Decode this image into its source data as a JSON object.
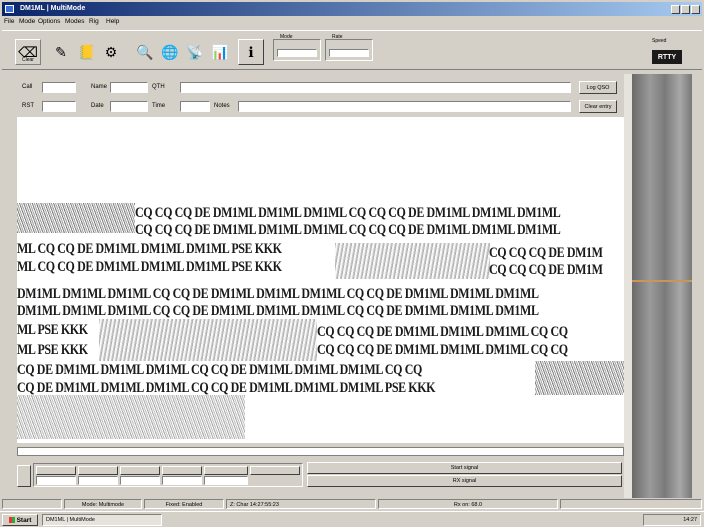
{
  "window": {
    "title": "DM1ML | MultiMode"
  },
  "menu": [
    "File",
    "Mode",
    "Options",
    "Modes",
    "Rig",
    "Help"
  ],
  "toolbar": {
    "buttons": [
      {
        "label": "Clear",
        "icon": "clear-icon",
        "glyph": "⌫"
      },
      {
        "label": "",
        "icon": "tools-icon",
        "glyph": "✎"
      },
      {
        "label": "",
        "icon": "log-icon",
        "glyph": "📒"
      },
      {
        "label": "",
        "icon": "settings-icon",
        "glyph": "⚙"
      },
      {
        "label": "",
        "icon": "search-icon",
        "glyph": "🔍"
      },
      {
        "label": "",
        "icon": "globe-icon",
        "glyph": "🌐"
      },
      {
        "label": "",
        "icon": "transmit-icon",
        "glyph": "📡"
      },
      {
        "label": "",
        "icon": "chart-icon",
        "glyph": "📊"
      },
      {
        "label": "",
        "icon": "info-icon",
        "glyph": "ℹ"
      }
    ],
    "group1": "Mode",
    "group2": "Rate"
  },
  "side": {
    "label": "Speed",
    "value": "RTTY"
  },
  "fields": {
    "call_label": "Call",
    "name_label": "Name",
    "qth_label": "QTH",
    "rst_label": "RST",
    "date_label": "Date",
    "time_label": "Time",
    "notes_label": "Notes",
    "log_button": "Log QSO",
    "clear_button": "Clear entry"
  },
  "decoder": {
    "lines": [
      "CQ CQ CQ DE DM1ML DM1ML DM1ML CQ CQ CQ DE DM1ML DM1ML DM1ML",
      "CQ CQ CQ DE DM1ML DM1ML DM1ML CQ CQ CQ DE DM1ML DM1ML DM1ML",
      "ML CQ CQ DE DM1ML DM1ML DM1ML PSE KKK",
      "ML CQ CQ DE DM1ML DM1ML DM1ML PSE KKK",
      "CQ CQ CQ DE DM1M",
      "CQ CQ CQ DE DM1M",
      "DM1ML DM1ML DM1ML CQ CQ DE DM1ML DM1ML DM1ML CQ CQ DE DM1ML DM1ML DM1ML",
      "DM1ML DM1ML DM1ML CQ CQ DE DM1ML DM1ML DM1ML CQ CQ DE DM1ML DM1ML DM1ML",
      "ML PSE KKK",
      "CQ CQ CQ DE DM1ML DM1ML DM1ML CQ CQ",
      "ML PSE KKK",
      "CQ CQ CQ DE DM1ML DM1ML DM1ML CQ CQ",
      "CQ DE DM1ML DM1ML DM1ML CQ CQ DE DM1ML DM1ML DM1ML CQ CQ",
      "CQ DE DM1ML DM1ML DM1ML CQ CQ DE DM1ML DM1ML DM1ML PSE KKK"
    ]
  },
  "bottom": {
    "tx_button": "Start signal",
    "rx_button": "RX signal"
  },
  "statusbar": {
    "panels": [
      "Mode: Multimode",
      "Fixed: Enabled",
      "Z: Char 14:27:55:23",
      "Rx on: 68.0"
    ]
  },
  "taskbar": {
    "start": "Start",
    "item": "DM1ML | MultiMode",
    "clock": "14:27"
  },
  "colors": {
    "titlebar_start": "#0a246a",
    "titlebar_end": "#a6caf0",
    "waterfall_signal": "#c9955a"
  }
}
